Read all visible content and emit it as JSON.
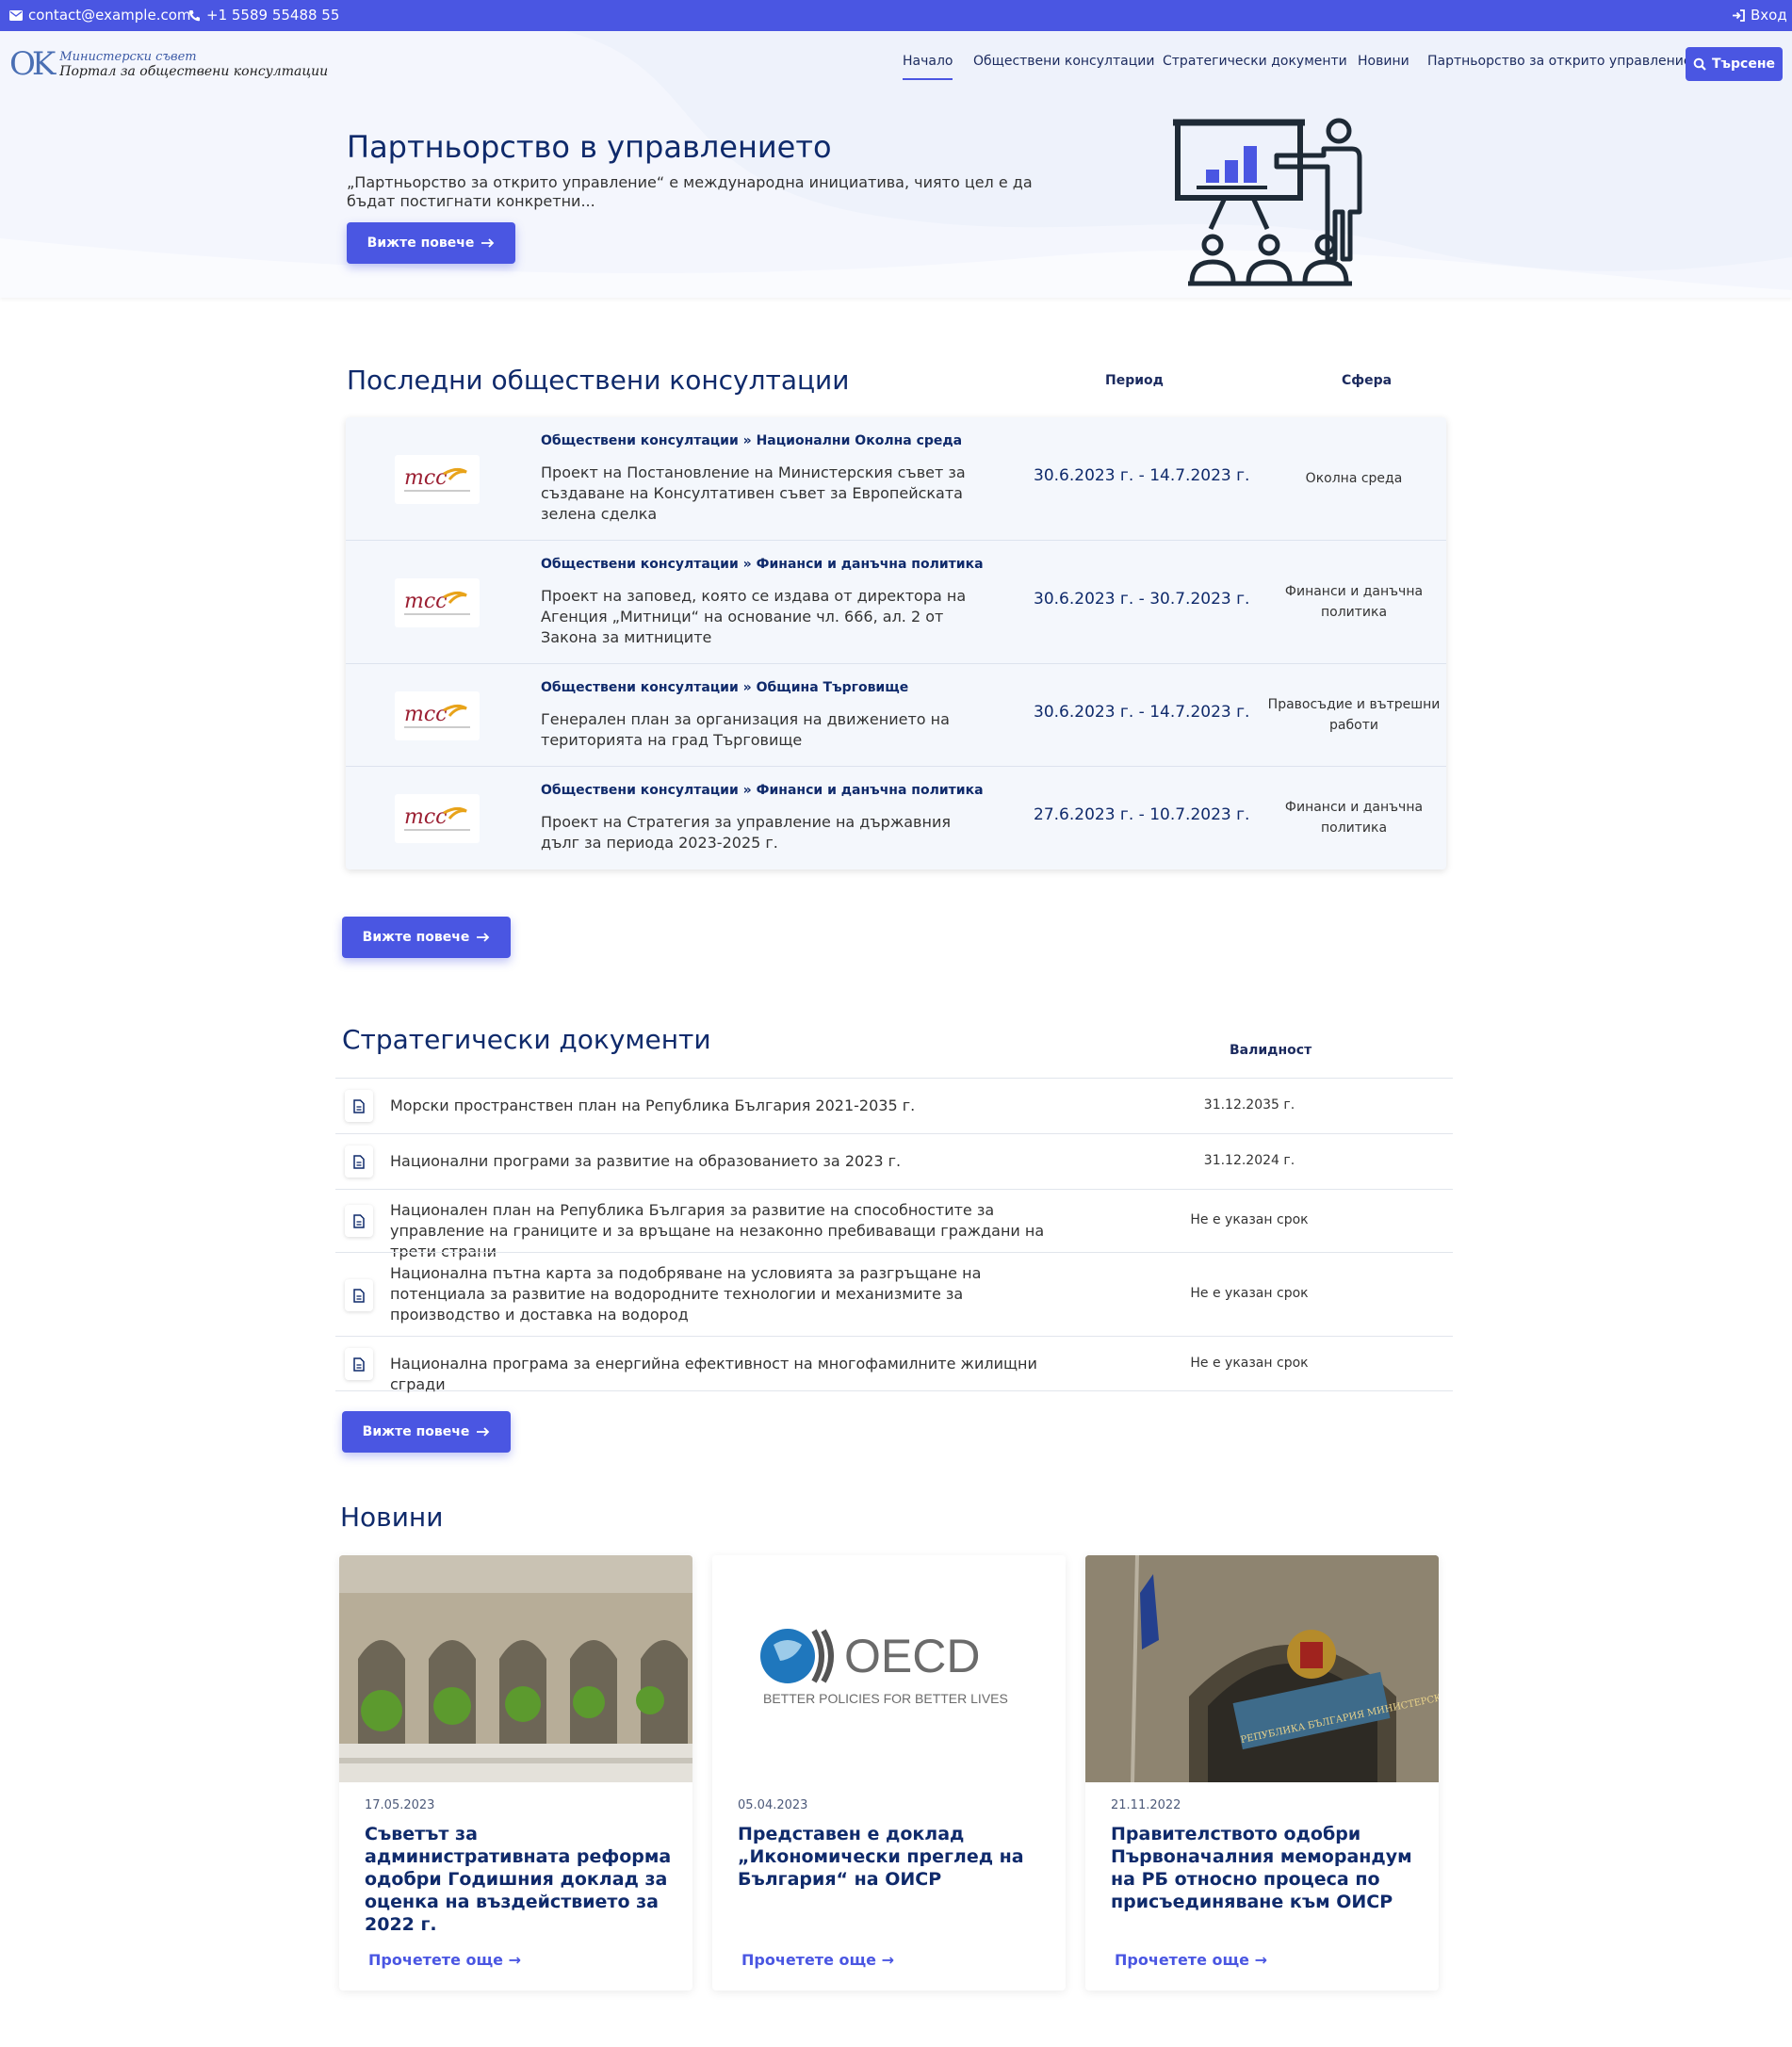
{
  "topbar": {
    "email": "contact@example.com",
    "phone": "+1 5589 55488 55",
    "login": "Вход"
  },
  "logo": {
    "mark": "OK",
    "line1": "Министерски съвет",
    "line2": "Портал за обществени консултации"
  },
  "nav": {
    "items": [
      "Начало",
      "Обществени консултации",
      "Стратегически документи",
      "Новини",
      "Партньорство за открито управление"
    ],
    "search": "Търсене"
  },
  "hero": {
    "title": "Партньорство в управлението",
    "text": "„Партньорство за открито управление“ е международна инициатива, чиято цел е да бъдат постигнати конкретни...",
    "button": "Вижте повече"
  },
  "consultations": {
    "title": "Последни обществени консултации",
    "col_period": "Период",
    "col_sphere": "Сфера",
    "logo_text": "mcc",
    "rows": [
      {
        "path": "Обществени консултации » Национални Околна среда",
        "title": "Проект на Постановление на Министерския съвет за създаване на Консултативен съвет за Европейската зелена сделка",
        "period": "30.6.2023 г. - 14.7.2023 г.",
        "sphere": "Околна среда"
      },
      {
        "path": "Обществени консултации » Финанси и данъчна политика",
        "title": "Проект на заповед, която се издава от директора на Агенция „Митници“ на основание чл. 666, ал. 2 от Закона за митниците",
        "period": "30.6.2023 г. - 30.7.2023 г.",
        "sphere": "Финанси и данъчна политика"
      },
      {
        "path": "Обществени консултации » Община Търговище",
        "title": "Генерален план за организация на движението на територията на град Търговище",
        "period": "30.6.2023 г. - 14.7.2023 г.",
        "sphere": "Правосъдие и вътрешни работи"
      },
      {
        "path": "Обществени консултации » Финанси и данъчна политика",
        "title": "Проект на Стратегия за управление на държавния дълг за периода 2023-2025 г.",
        "period": "27.6.2023 г. - 10.7.2023 г.",
        "sphere": "Финанси и данъчна политика"
      }
    ],
    "button": "Вижте повече"
  },
  "strategic": {
    "title": "Стратегически документи",
    "col_validity": "Валидност",
    "rows": [
      {
        "title": "Морски пространствен план на Република България 2021-2035 г.",
        "validity": "31.12.2035 г."
      },
      {
        "title": "Национални програми за развитие на образованието за 2023 г.",
        "validity": "31.12.2024 г."
      },
      {
        "title": "Национален план на Република България за развитие на способностите за управление на границите и за връщане на незаконно пребиваващи граждани на трети страни",
        "validity": "Не е указан срок"
      },
      {
        "title": "Национална пътна карта за подобряване на условията за разгръщане на потенциала за развитие на водородните технологии и механизмите за производство и доставка на водород",
        "validity": "Не е указан срок"
      },
      {
        "title": "Национална програма за енергийна ефективност на многофамилните жилищни сгради",
        "validity": "Не е указан срок"
      }
    ],
    "button": "Вижте повече"
  },
  "news": {
    "title": "Новини",
    "oecd_name": "OECD",
    "oecd_slogan": "BETTER POLICIES FOR BETTER LIVES",
    "seal_text": "РЕПУБЛИКА БЪЛГАРИЯ МИНИСТЕРСКИ СЪВЕТ",
    "cards": [
      {
        "date": "17.05.2023",
        "title": "Съветът за административната реформа одобри Годишния доклад за оценка на въздействието за 2022 г.",
        "more": "Прочетете още"
      },
      {
        "date": "05.04.2023",
        "title": "Представен е доклад „Икономически преглед на България“ на ОИСР",
        "more": "Прочетете още"
      },
      {
        "date": "21.11.2022",
        "title": "Правителството одобри Първоначалния меморандум на РБ относно процеса по присъединяване към ОИСР",
        "more": "Прочетете още"
      }
    ]
  },
  "colors": {
    "accent": "#4a56e2",
    "navy": "#0f2a6b",
    "hero_bg": "#eef2fb"
  }
}
